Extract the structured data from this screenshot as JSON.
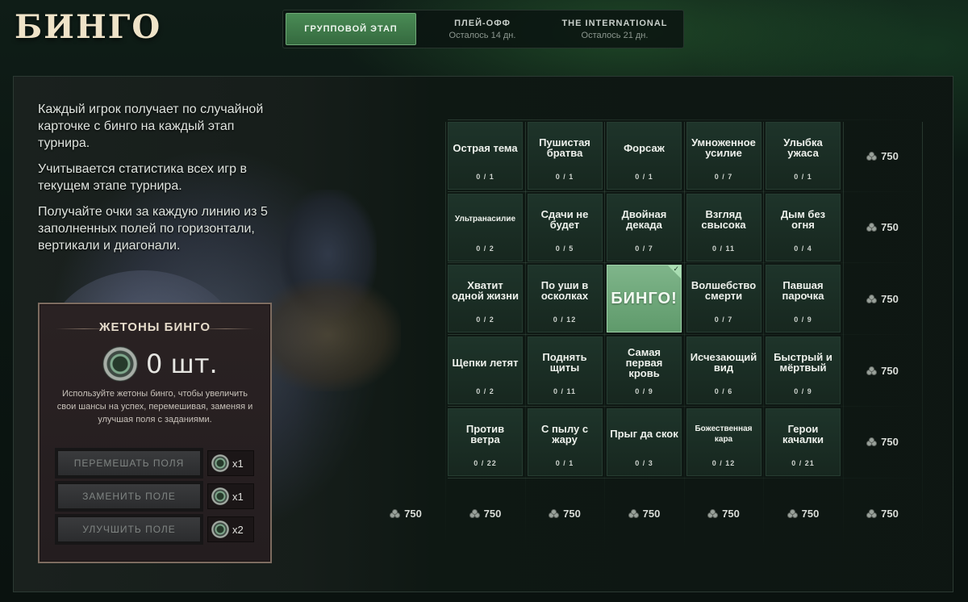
{
  "title": "БИНГО",
  "tabs": [
    {
      "label": "ГРУППОВОЙ ЭТАП",
      "sub": ""
    },
    {
      "label": "ПЛЕЙ-ОФФ",
      "sub": "Осталось 14 дн."
    },
    {
      "label": "THE INTERNATIONAL",
      "sub": "Осталось 21 дн."
    }
  ],
  "description": [
    "Каждый игрок получает по случайной карточке с бинго на каждый этап турнира.",
    "Учитывается статистика всех игр в текущем этапе турнира.",
    "Получайте очки за каждую линию из 5 заполненных полей по горизонтали, вертикали и диагонали."
  ],
  "tokens": {
    "title": "ЖЕТОНЫ БИНГО",
    "count": "0 шт.",
    "description": "Используйте жетоны бинго, чтобы увеличить свои шансы на успех, перемешивая, заменяя и улучшая поля с заданиями.",
    "actions": [
      {
        "label": "ПЕРЕМЕШАТЬ ПОЛЯ",
        "cost": "x1"
      },
      {
        "label": "ЗАМЕНИТЬ ПОЛЕ",
        "cost": "x1"
      },
      {
        "label": "УЛУЧШИТЬ ПОЛЕ",
        "cost": "x2"
      }
    ]
  },
  "board": {
    "cells": [
      [
        {
          "name": "Острая тема",
          "progress": "0 / 1"
        },
        {
          "name": "Пушистая братва",
          "progress": "0 / 1"
        },
        {
          "name": "Форсаж",
          "progress": "0 / 1"
        },
        {
          "name": "Умноженное усилие",
          "progress": "0 / 7"
        },
        {
          "name": "Улыбка ужаса",
          "progress": "0 / 1"
        }
      ],
      [
        {
          "name": "Ультранасилие",
          "progress": "0 / 2",
          "small": true
        },
        {
          "name": "Сдачи не будет",
          "progress": "0 / 5"
        },
        {
          "name": "Двойная декада",
          "progress": "0 / 7"
        },
        {
          "name": "Взгляд свысока",
          "progress": "0 / 11"
        },
        {
          "name": "Дым без огня",
          "progress": "0 / 4"
        }
      ],
      [
        {
          "name": "Хватит одной жизни",
          "progress": "0 / 2"
        },
        {
          "name": "По уши в осколках",
          "progress": "0 / 12"
        },
        {
          "name": "БИНГО!",
          "progress": "",
          "done": true
        },
        {
          "name": "Волшебство смерти",
          "progress": "0 / 7"
        },
        {
          "name": "Павшая парочка",
          "progress": "0 / 9"
        }
      ],
      [
        {
          "name": "Щепки летят",
          "progress": "0 / 2"
        },
        {
          "name": "Поднять щиты",
          "progress": "0 / 11"
        },
        {
          "name": "Самая первая кровь",
          "progress": "0 / 9"
        },
        {
          "name": "Исчезающий вид",
          "progress": "0 / 6"
        },
        {
          "name": "Быстрый и мёртвый",
          "progress": "0 / 9"
        }
      ],
      [
        {
          "name": "Против ветра",
          "progress": "0 / 22"
        },
        {
          "name": "С пылу с жару",
          "progress": "0 / 1"
        },
        {
          "name": "Прыг да скок",
          "progress": "0 / 3"
        },
        {
          "name": "Божественная кара",
          "progress": "0 / 12",
          "small": true
        },
        {
          "name": "Герои качалки",
          "progress": "0 / 21"
        }
      ]
    ],
    "row_rewards": [
      "750",
      "750",
      "750",
      "750",
      "750"
    ],
    "bottom_rewards": [
      "750",
      "750",
      "750",
      "750",
      "750",
      "750",
      "750"
    ]
  }
}
